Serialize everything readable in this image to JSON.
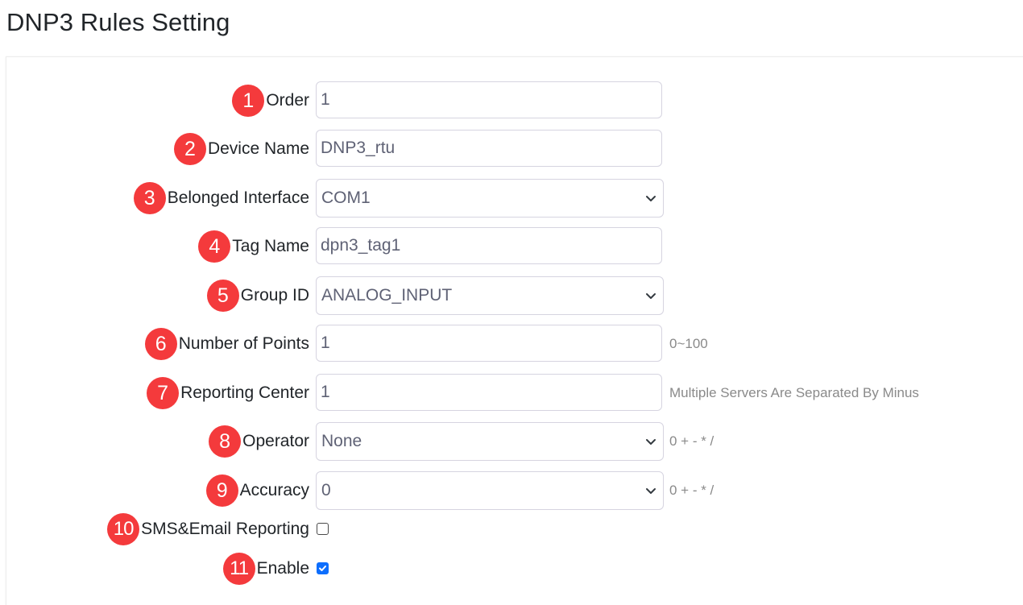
{
  "page": {
    "title": "DNP3 Rules Setting"
  },
  "colors": {
    "badge": "#f43a3c",
    "checkbox_checked": "#0d6efd"
  },
  "form": {
    "order": {
      "badge": "1",
      "label": "Order",
      "value": "1"
    },
    "device_name": {
      "badge": "2",
      "label": "Device Name",
      "value": "DNP3_rtu"
    },
    "belonged_interface": {
      "badge": "3",
      "label": "Belonged Interface",
      "selected": "COM1",
      "icon": "chevron-down-icon"
    },
    "tag_name": {
      "badge": "4",
      "label": "Tag Name",
      "value": "dpn3_tag1"
    },
    "group_id": {
      "badge": "5",
      "label": "Group ID",
      "selected": "ANALOG_INPUT",
      "icon": "chevron-down-icon"
    },
    "number_of_points": {
      "badge": "6",
      "label": "Number of Points",
      "value": "1",
      "hint": "0~100"
    },
    "reporting_center": {
      "badge": "7",
      "label": "Reporting Center",
      "value": "1",
      "hint": "Multiple Servers Are Separated By Minus"
    },
    "operator": {
      "badge": "8",
      "label": "Operator",
      "selected": "None",
      "hint": "0 + - * /",
      "icon": "chevron-down-icon"
    },
    "accuracy": {
      "badge": "9",
      "label": "Accuracy",
      "selected": "0",
      "hint": "0 + - * /",
      "icon": "chevron-down-icon"
    },
    "sms_email_reporting": {
      "badge": "10",
      "label": "SMS&Email Reporting",
      "checked": false
    },
    "enable": {
      "badge": "11",
      "label": "Enable",
      "checked": true
    }
  }
}
